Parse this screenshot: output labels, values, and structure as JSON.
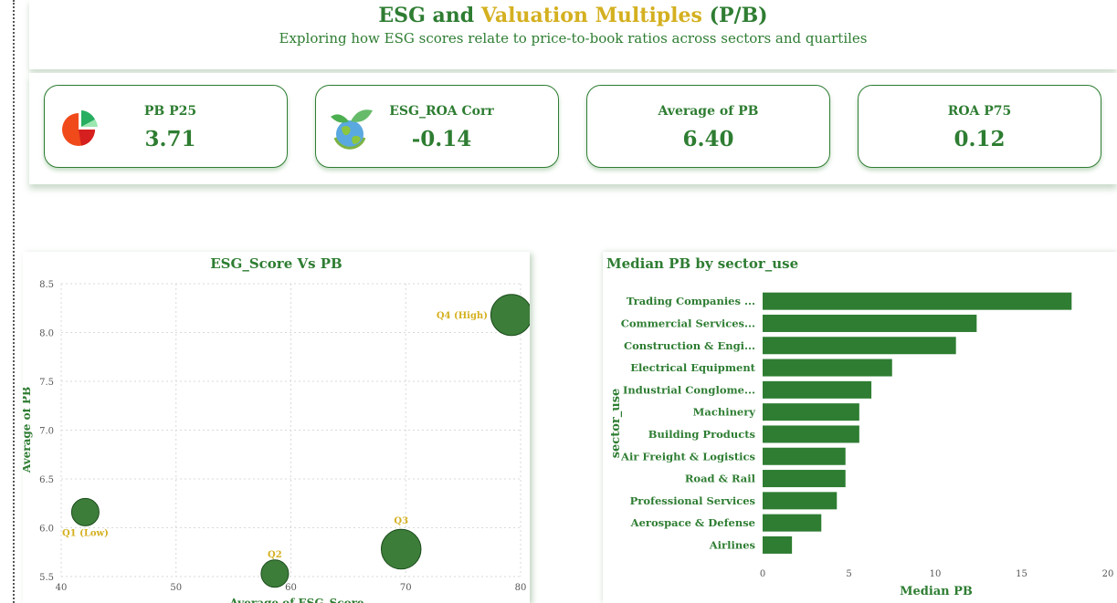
{
  "header": {
    "title_part1": "ESG and ",
    "title_accent": "Valuation Multiples",
    "title_part2": " (P/B)",
    "subtitle": "Exploring how ESG scores relate to price-to-book ratios across sectors and quartiles"
  },
  "kpis": [
    {
      "label": "PB P25",
      "value": "3.71",
      "icon": "pie-chart-icon"
    },
    {
      "label": "ESG_ROA Corr",
      "value": "-0.14",
      "icon": "green-earth-icon"
    },
    {
      "label": "Average of PB",
      "value": "6.40"
    },
    {
      "label": "ROA P75",
      "value": "0.12"
    }
  ],
  "colors": {
    "primary_green": "#2e7d32",
    "accent_gold": "#d4b020",
    "bubble_green": "#3d7d3a",
    "bar_green": "#2e7d32"
  },
  "scatter": {
    "title": "ESG_Score Vs PB"
  },
  "bars": {
    "title": "Median PB by sector_use"
  },
  "chart_data": [
    {
      "type": "scatter",
      "title": "ESG_Score Vs PB",
      "xlabel": "Average of ESG_Score",
      "ylabel": "Average of PB",
      "xlim": [
        40,
        80
      ],
      "ylim": [
        5.5,
        8.5
      ],
      "xticks": [
        40,
        50,
        60,
        70,
        80
      ],
      "yticks": [
        5.5,
        6.0,
        6.5,
        7.0,
        7.5,
        8.0,
        8.5
      ],
      "grid": true,
      "points": [
        {
          "label": "Q1 (Low)",
          "x": 42.1,
          "y": 6.16,
          "size": 1.0
        },
        {
          "label": "Q2",
          "x": 58.6,
          "y": 5.53,
          "size": 1.0
        },
        {
          "label": "Q3",
          "x": 69.6,
          "y": 5.78,
          "size": 1.45
        },
        {
          "label": "Q4 (High)",
          "x": 79.2,
          "y": 8.18,
          "size": 1.5
        }
      ]
    },
    {
      "type": "bar",
      "orientation": "horizontal",
      "title": "Median PB by sector_use",
      "xlabel": "Median PB",
      "ylabel": "sector_use",
      "xlim": [
        0,
        20
      ],
      "xticks": [
        0,
        5,
        10,
        15,
        20
      ],
      "categories": [
        "Trading Companies ...",
        "Commercial Services...",
        "Construction & Engi...",
        "Electrical Equipment",
        "Industrial Conglome...",
        "Machinery",
        "Building Products",
        "Air Freight & Logistics",
        "Road & Rail",
        "Professional Services",
        "Aerospace & Defense",
        "Airlines"
      ],
      "values": [
        17.9,
        12.4,
        11.2,
        7.5,
        6.3,
        5.6,
        5.6,
        4.8,
        4.8,
        4.3,
        3.4,
        1.7
      ]
    }
  ]
}
